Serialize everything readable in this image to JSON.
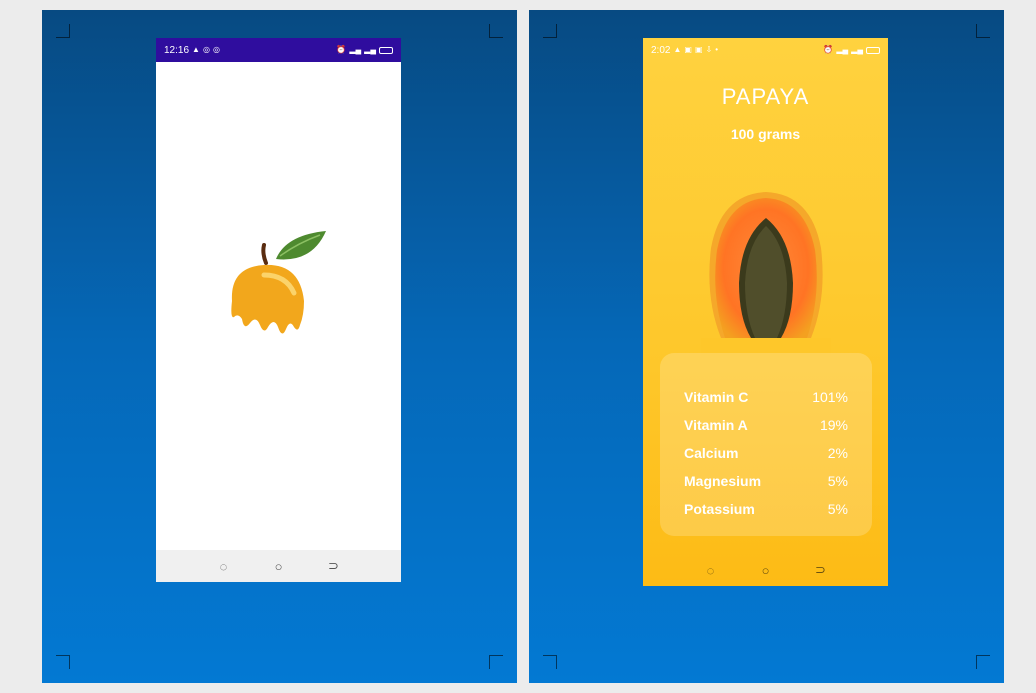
{
  "left_screen": {
    "status_time": "12:16",
    "status_icons_left": [
      "notification-icon",
      "app-icon",
      "app-icon"
    ],
    "status_icons_right": [
      "alarm-icon",
      "signal-icon",
      "signal-icon",
      "battery-icon"
    ]
  },
  "right_screen": {
    "status_time": "2:02",
    "title": "PAPAYA",
    "subtitle": "100 grams",
    "nutrients": [
      {
        "name": "Vitamin C",
        "value": "101%"
      },
      {
        "name": "Vitamin A",
        "value": "19%"
      },
      {
        "name": "Calcium",
        "value": "2%"
      },
      {
        "name": "Magnesium",
        "value": "5%"
      },
      {
        "name": "Potassium",
        "value": "5%"
      }
    ]
  },
  "colors": {
    "splash_statusbar": "#2f0d9e",
    "detail_background": "#fec72a",
    "slide_background": "#0568b8",
    "logo_fruit": "#f2a71c",
    "logo_leaf": "#4e8a2f"
  }
}
